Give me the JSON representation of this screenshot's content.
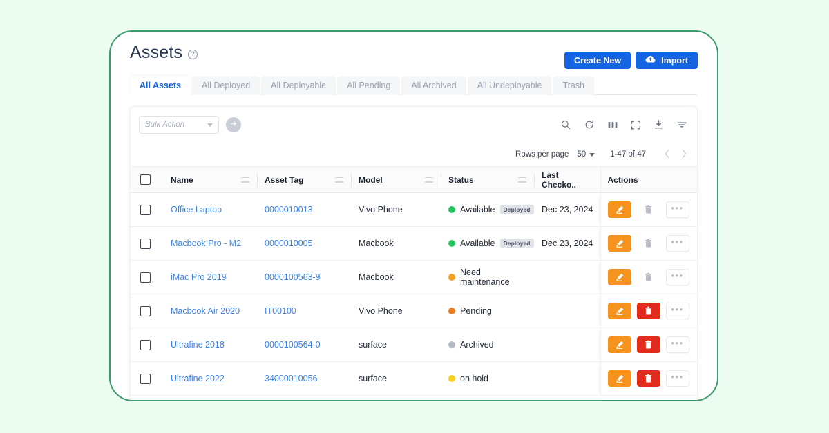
{
  "header": {
    "title": "Assets",
    "help_icon": "question-circle-icon",
    "create_label": "Create New",
    "import_label": "Import"
  },
  "tabs": [
    {
      "label": "All Assets",
      "active": true
    },
    {
      "label": "All Deployed",
      "active": false
    },
    {
      "label": "All Deployable",
      "active": false
    },
    {
      "label": "All Pending",
      "active": false
    },
    {
      "label": "All Archived",
      "active": false
    },
    {
      "label": "All Undeployable",
      "active": false
    },
    {
      "label": "Trash",
      "active": false
    }
  ],
  "toolbar": {
    "bulk_action_placeholder": "Bulk Action",
    "go_icon": "arrow-right-icon",
    "icons": [
      "search-icon",
      "refresh-icon",
      "columns-icon",
      "fullscreen-icon",
      "download-icon",
      "filter-icon"
    ]
  },
  "pagination": {
    "rows_per_page_label": "Rows per page",
    "rows_per_page_value": "50",
    "range_label": "1-47 of 47",
    "prev_icon": "chevron-left-icon",
    "next_icon": "chevron-right-icon"
  },
  "table": {
    "columns": [
      "Name",
      "Asset Tag",
      "Model",
      "Status",
      "Last Checko..",
      "Actions"
    ],
    "rows": [
      {
        "name": "Office Laptop",
        "asset_tag": "0000010013",
        "model": "Vivo Phone",
        "status": "Available",
        "status_color": "#22c55e",
        "badge": "Deployed",
        "last_checkout": "Dec 23, 2024",
        "delete_enabled": false
      },
      {
        "name": "Macbook Pro - M2",
        "asset_tag": "0000010005",
        "model": "Macbook",
        "status": "Available",
        "status_color": "#22c55e",
        "badge": "Deployed",
        "last_checkout": "Dec 23, 2024",
        "delete_enabled": false
      },
      {
        "name": "iMac Pro 2019",
        "asset_tag": "0000100563-9",
        "model": "Macbook",
        "status": "Need maintenance",
        "status_color": "#f5a020",
        "badge": "",
        "last_checkout": "",
        "delete_enabled": false
      },
      {
        "name": "Macbook Air 2020",
        "asset_tag": "IT00100",
        "model": "Vivo Phone",
        "status": "Pending",
        "status_color": "#f07b1d",
        "badge": "",
        "last_checkout": "",
        "delete_enabled": true
      },
      {
        "name": "Ultrafine 2018",
        "asset_tag": "0000100564-0",
        "model": "surface",
        "status": "Archived",
        "status_color": "#b6bbc3",
        "badge": "",
        "last_checkout": "",
        "delete_enabled": true
      },
      {
        "name": "Ultrafine 2022",
        "asset_tag": "34000010056",
        "model": "surface",
        "status": "on hold",
        "status_color": "#f5d020",
        "badge": "",
        "last_checkout": "",
        "delete_enabled": true
      }
    ],
    "action_icons": {
      "edit": "pencil-icon",
      "delete": "trash-icon",
      "more": "ellipsis-icon"
    }
  },
  "colors": {
    "page_background": "#eafdf0",
    "card_border": "#3c9a6d",
    "primary": "#1565e0",
    "edit": "#f6921e",
    "delete": "#e02b1d",
    "link": "#3b82e8"
  }
}
